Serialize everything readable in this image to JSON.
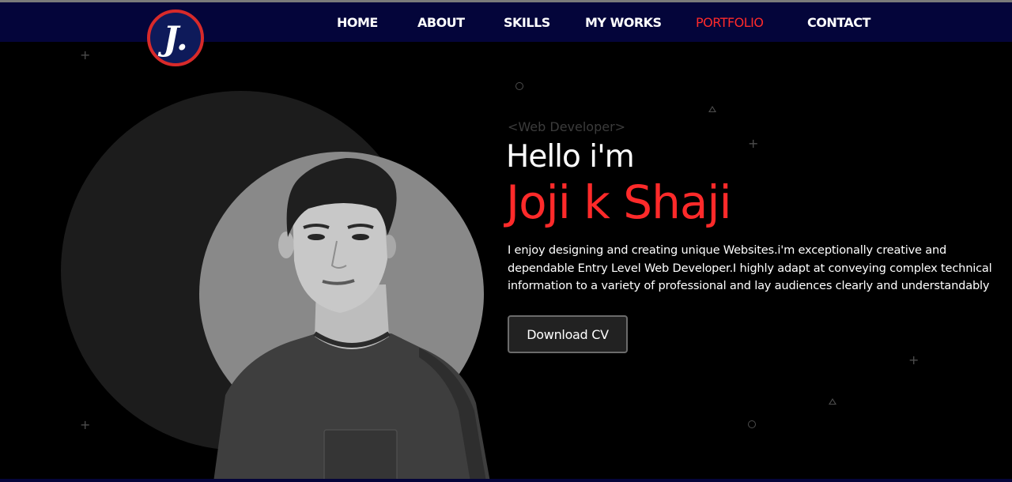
{
  "logo": {
    "letter": "J."
  },
  "nav": {
    "items": [
      {
        "label": "HOME"
      },
      {
        "label": "ABOUT"
      },
      {
        "label": "SKILLS"
      },
      {
        "label": "MY WORKS"
      },
      {
        "label": "PORTFOLIO",
        "active": true
      },
      {
        "label": "CONTACT"
      }
    ]
  },
  "hero": {
    "subtitle": "<Web Developer>",
    "greeting": "Hello i'm",
    "name": "Joji k Shaji",
    "bio": "I enjoy designing and creating unique Websites.i'm exceptionally creative and dependable Entry Level Web Developer.I highly adapt at conveying complex technical information to a variety of professional and lay audiences clearly and understandably",
    "cv_button": "Download CV"
  },
  "colors": {
    "nav_background": "#04053a",
    "accent": "#ff2a2a",
    "page_background": "#000000"
  }
}
